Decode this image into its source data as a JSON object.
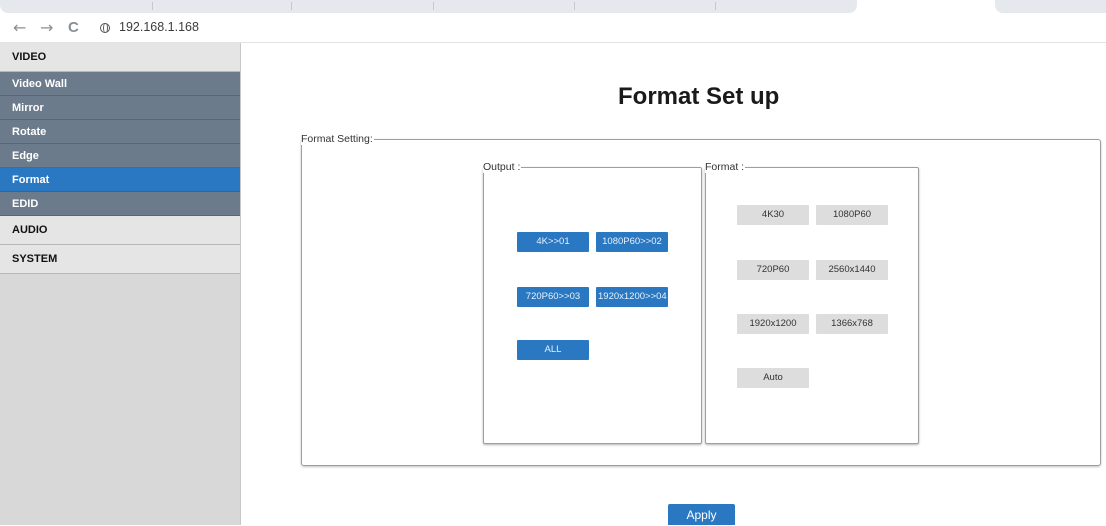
{
  "browser": {
    "address": "192.168.1.168",
    "back_icon": "←",
    "forward_icon": "→",
    "reload_icon": "C"
  },
  "sidebar": {
    "items": [
      {
        "label": "VIDEO"
      },
      {
        "label": "Video Wall"
      },
      {
        "label": "Mirror"
      },
      {
        "label": "Rotate"
      },
      {
        "label": "Edge"
      },
      {
        "label": "Format"
      },
      {
        "label": "EDID"
      },
      {
        "label": "AUDIO"
      },
      {
        "label": "SYSTEM"
      }
    ],
    "active": "Format"
  },
  "main": {
    "title": "Format Set up",
    "format_setting_legend": "Format Setting:",
    "output": {
      "legend": "Output :",
      "buttons": [
        "4K>>01",
        "1080P60>>02",
        "720P60>>03",
        "1920x1200>>04",
        "ALL"
      ]
    },
    "format": {
      "legend": "Format :",
      "buttons": [
        "4K30",
        "1080P60",
        "720P60",
        "2560x1440",
        "1920x1200",
        "1366x768",
        "Auto"
      ]
    },
    "apply_label": "Apply"
  },
  "colors": {
    "accent_blue": "#2a78c2",
    "sidebar_sub": "#6b7b8c",
    "sidebar_bg": "#d8d8d8"
  }
}
